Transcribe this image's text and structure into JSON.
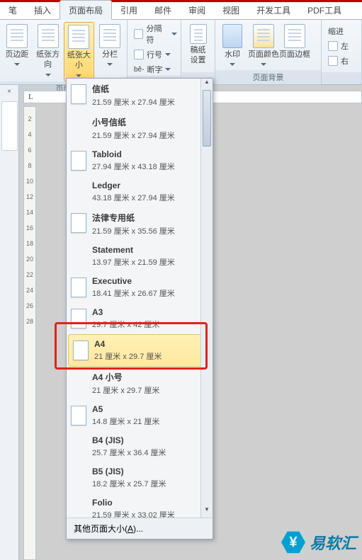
{
  "tabs": {
    "t0": "笔",
    "t1": "插入",
    "t2": "页面布局",
    "t3": "引用",
    "t4": "邮件",
    "t5": "审阅",
    "t6": "视图",
    "t7": "开发工具",
    "t8": "PDF工具"
  },
  "ribbon": {
    "page_margin": "页边距",
    "orientation": "纸张方向",
    "size": "纸张大小",
    "columns": "分栏",
    "breaks": "分隔符",
    "line_no": "行号",
    "hyphen": "断字",
    "manuscript": "稿纸",
    "manuscript2": "设置",
    "watermark": "水印",
    "pagecolor": "页面颜色",
    "pageborder": "页面边框",
    "indent": "缩进",
    "left": "左",
    "right": "右",
    "group_page": "页面",
    "group_bg": "页面背景"
  },
  "ruler_L": "L",
  "ruler_ticks": [
    "2",
    "4",
    "6",
    "8",
    "10",
    "12",
    "14",
    "16",
    "18",
    "20",
    "22",
    "24",
    "26",
    "28"
  ],
  "sizes": [
    {
      "name": "信纸",
      "dims": "21.59 厘米 x 27.94 厘米",
      "thumb": true
    },
    {
      "name": "小号信纸",
      "dims": "21.59 厘米 x 27.94 厘米",
      "thumb": false
    },
    {
      "name": "Tabloid",
      "dims": "27.94 厘米 x 43.18 厘米",
      "thumb": true
    },
    {
      "name": "Ledger",
      "dims": "43.18 厘米 x 27.94 厘米",
      "thumb": false
    },
    {
      "name": "法律专用纸",
      "dims": "21.59 厘米 x 35.56 厘米",
      "thumb": true
    },
    {
      "name": "Statement",
      "dims": "13.97 厘米 x 21.59 厘米",
      "thumb": false
    },
    {
      "name": "Executive",
      "dims": "18.41 厘米 x 26.67 厘米",
      "thumb": true
    },
    {
      "name": "A3",
      "dims": "29.7 厘米 x 42 厘米",
      "thumb": true
    },
    {
      "name": "A4",
      "dims": "21 厘米 x 29.7 厘米",
      "thumb": true,
      "selected": true
    },
    {
      "name": "A4 小号",
      "dims": "21 厘米 x 29.7 厘米",
      "thumb": false
    },
    {
      "name": "A5",
      "dims": "14.8 厘米 x 21 厘米",
      "thumb": true
    },
    {
      "name": "B4 (JIS)",
      "dims": "25.7 厘米 x 36.4 厘米",
      "thumb": false
    },
    {
      "name": "B5 (JIS)",
      "dims": "18.2 厘米 x 25.7 厘米",
      "thumb": false
    },
    {
      "name": "Folio",
      "dims": "21.59 厘米 x 33.02 厘米",
      "thumb": false
    }
  ],
  "footer_pre": "其他页面大小(",
  "footer_key": "A",
  "footer_post": ")...",
  "logo": "易软汇",
  "logo_icon": "¥"
}
